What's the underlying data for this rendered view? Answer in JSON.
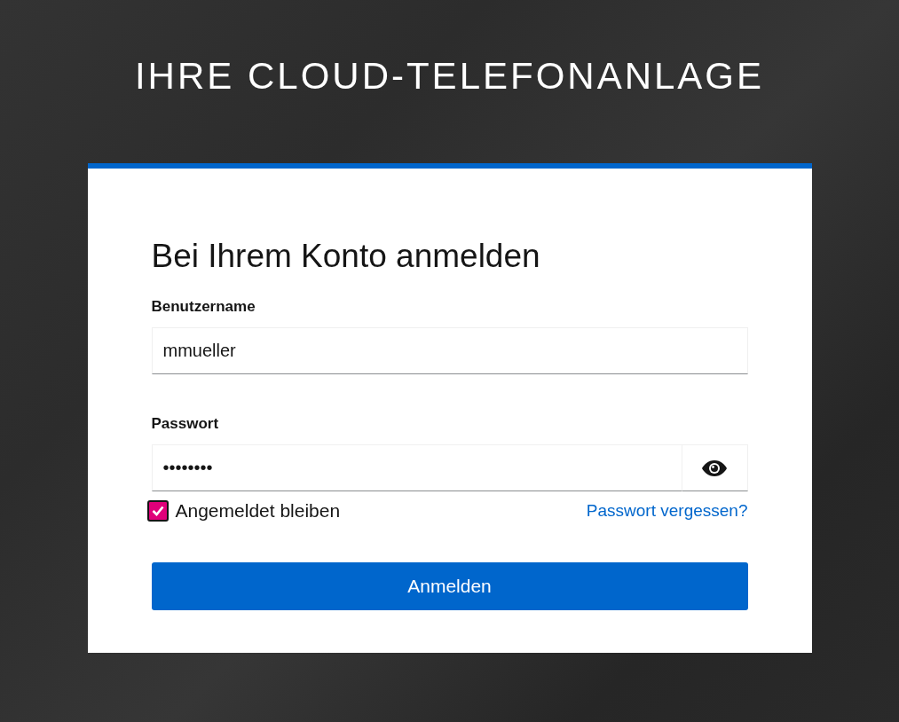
{
  "header": {
    "title": "IHRE CLOUD-TELEFONANLAGE"
  },
  "login": {
    "heading": "Bei Ihrem Konto anmelden",
    "username": {
      "label": "Benutzername",
      "value": "mmueller"
    },
    "password": {
      "label": "Passwort",
      "value": "••••••••"
    },
    "remember": {
      "label": "Angemeldet bleiben",
      "checked": true
    },
    "forgot_link": "Passwort vergessen?",
    "submit": "Anmelden"
  }
}
